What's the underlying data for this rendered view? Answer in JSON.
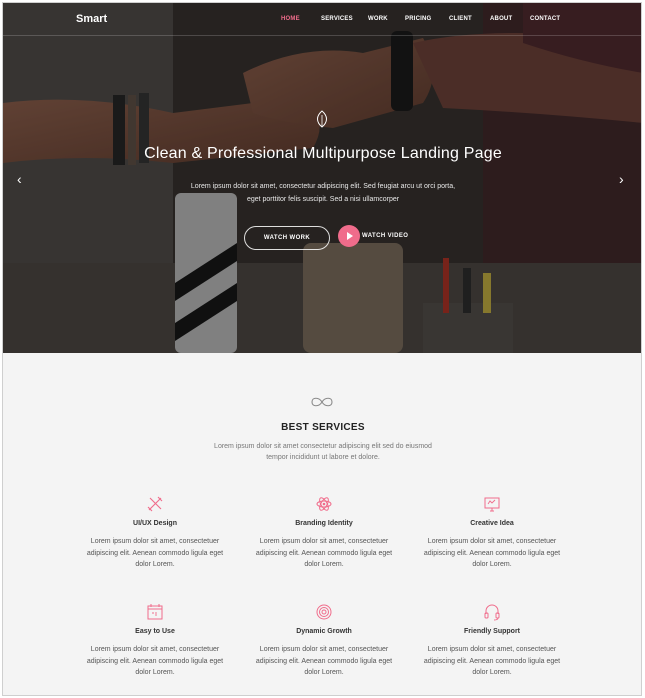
{
  "brand": "Smart",
  "nav": {
    "items": [
      "HOME",
      "SERVICES",
      "WORK",
      "PRICING",
      "CLIENT",
      "ABOUT",
      "CONTACT"
    ],
    "active": "HOME"
  },
  "hero": {
    "title": "Clean & Professional Multipurpose Landing Page",
    "subtitle_line1": "Lorem ipsum dolor sit amet, consectetur adipiscing elit. Sed feugiat arcu ut orci porta,",
    "subtitle_line2": "eget porttitor felis suscipit. Sed a nisi ullamcorper",
    "watch_work_label": "WATCH WORK",
    "watch_video_label": "WATCH VIDEO",
    "prev_icon": "chevron-left-icon",
    "next_icon": "chevron-right-icon",
    "leaf_icon": "leaf-icon"
  },
  "services": {
    "icon": "infinity-icon",
    "title": "BEST SERVICES",
    "subtitle_line1": "Lorem ipsum dolor sit amet consectetur adipiscing elit sed do eiusmod",
    "subtitle_line2": "tempor incididunt ut labore et dolore.",
    "items": [
      {
        "title": "UI/UX Design",
        "icon": "tools-icon",
        "l1": "Lorem ipsum dolor sit amet, consectetuer",
        "l2": "adipiscing elit. Aenean commodo ligula eget",
        "l3": "dolor Lorem."
      },
      {
        "title": "Branding Identity",
        "icon": "atom-icon",
        "l1": "Lorem ipsum dolor sit amet, consectetuer",
        "l2": "adipiscing elit. Aenean commodo ligula eget",
        "l3": "dolor Lorem."
      },
      {
        "title": "Creative Idea",
        "icon": "monitor-icon",
        "l1": "Lorem ipsum dolor sit amet, consectetuer",
        "l2": "adipiscing elit. Aenean commodo ligula eget",
        "l3": "dolor Lorem."
      },
      {
        "title": "Easy to Use",
        "icon": "calendar-icon",
        "l1": "Lorem ipsum dolor sit amet, consectetuer",
        "l2": "adipiscing elit. Aenean commodo ligula eget",
        "l3": "dolor Lorem."
      },
      {
        "title": "Dynamic Growth",
        "icon": "target-icon",
        "l1": "Lorem ipsum dolor sit amet, consectetuer",
        "l2": "adipiscing elit. Aenean commodo ligula eget",
        "l3": "dolor Lorem."
      },
      {
        "title": "Friendly Support",
        "icon": "headset-icon",
        "l1": "Lorem ipsum dolor sit amet, consectetuer",
        "l2": "adipiscing elit. Aenean commodo ligula eget",
        "l3": "dolor Lorem."
      }
    ]
  },
  "colors": {
    "accent": "#f06c8b",
    "hero_overlay": "#2a2522",
    "section_bg": "#f4f4f4"
  }
}
